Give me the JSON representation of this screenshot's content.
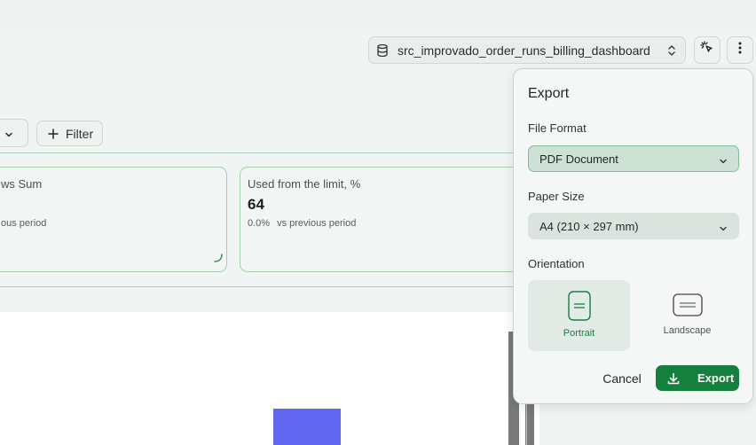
{
  "header": {
    "datasource": "src_improvado_order_runs_billing_dashboard"
  },
  "toolbar": {
    "filter_label": "Filter"
  },
  "cards": [
    {
      "title": "ws Sum",
      "value": "",
      "delta": "",
      "compare": "ous period"
    },
    {
      "title": "Used from the limit, %",
      "value": "64",
      "delta": "0.0%",
      "compare": "vs previous period"
    }
  ],
  "export_panel": {
    "title": "Export",
    "file_format_label": "File Format",
    "file_format_value": "PDF Document",
    "paper_size_label": "Paper Size",
    "paper_size_value": "A4 (210 × 297 mm)",
    "orientation_label": "Orientation",
    "orientation_options": [
      "Portrait",
      "Landscape"
    ],
    "selected_orientation": "Portrait",
    "cancel_label": "Cancel",
    "export_label": "Export"
  },
  "colors": {
    "accent": "#15803d",
    "bar": "#6366f1",
    "card_border": "#9fd1ae"
  },
  "icons": [
    "database-icon",
    "updown-chevron-icon",
    "cursor-sparkle-icon",
    "more-vertical-icon",
    "chevron-down-icon",
    "plus-icon",
    "download-icon",
    "portrait-page-icon",
    "landscape-page-icon"
  ]
}
